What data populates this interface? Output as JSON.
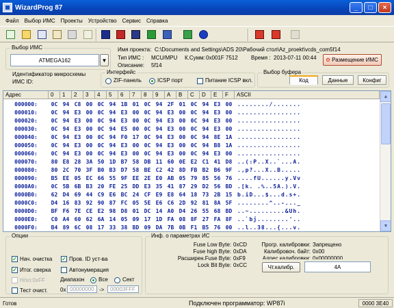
{
  "window": {
    "title": "WizardProg 87",
    "minimize": "_",
    "maximize": "□",
    "close": "×"
  },
  "menu": [
    "Файл",
    "Выбор ИМС",
    "Проекты",
    "Устройство",
    "Сервис",
    "Справка"
  ],
  "toolbar_icons": [
    "new-file-icon",
    "open-folder-icon",
    "save-icon",
    "reload-icon",
    "print-icon",
    "read-chip-icon",
    "erase-chip-icon",
    "blank-check-icon",
    "program-chip-icon",
    "verify-chip-icon",
    "auto-icon",
    "info-icon",
    "device-setup-icon",
    "device-select-icon",
    "disabled-edit-icon"
  ],
  "chip_select": {
    "title": "Выбор ИМС",
    "value": "ATMEGA162"
  },
  "project": {
    "name_label": "Имя проекта:",
    "name_value": "C:\\Documents and Settings\\ADS 20\\Рабочий стол\\Az_proekt\\vcds_com5f14",
    "type_label": "Тип ИМС :",
    "type_value": "MCU/MPU",
    "checksum_label": "К.Сумм:",
    "checksum_value": "0x001F 7512",
    "time_label": "Время :",
    "time_value": "2013-07-11 00:44",
    "desc_label": "Описание:",
    "desc_value": "5f14",
    "placement_button": "Размещение ИМС"
  },
  "chip_id": {
    "title": "Идентификатор микросхемы",
    "label": "ИМС ID:"
  },
  "interface": {
    "title": "Интерфейс",
    "zif": "ZIF-панель",
    "icsp": "ICSP порт",
    "icsp_power": "Питание ICSP вкл."
  },
  "buffer": {
    "title": "Выбор буфера",
    "tabs": [
      "Код",
      "Данные",
      "Конфиг"
    ]
  },
  "hex": {
    "headers": [
      "Адрес",
      "0",
      "1",
      "2",
      "3",
      "4",
      "5",
      "6",
      "7",
      "8",
      "9",
      "A",
      "B",
      "C",
      "D",
      "E",
      "F",
      "ASCII"
    ],
    "rows": [
      {
        "addr": "000000:",
        "bytes": [
          "0C",
          "94",
          "C8",
          "00",
          "0C",
          "94",
          "1B",
          "01",
          "0C",
          "94",
          "2F",
          "01",
          "0C",
          "94",
          "E3",
          "00"
        ],
        "ascii": "......../......."
      },
      {
        "addr": "000010:",
        "bytes": [
          "0C",
          "94",
          "E3",
          "00",
          "0C",
          "94",
          "E3",
          "00",
          "0C",
          "94",
          "E3",
          "00",
          "0C",
          "94",
          "E3",
          "00"
        ],
        "ascii": "................"
      },
      {
        "addr": "000020:",
        "bytes": [
          "0C",
          "94",
          "E3",
          "00",
          "0C",
          "94",
          "E3",
          "00",
          "0C",
          "94",
          "E3",
          "00",
          "0C",
          "94",
          "E3",
          "00"
        ],
        "ascii": "................"
      },
      {
        "addr": "000030:",
        "bytes": [
          "0C",
          "94",
          "E3",
          "00",
          "0C",
          "94",
          "E5",
          "00",
          "0C",
          "94",
          "E3",
          "00",
          "0C",
          "94",
          "E3",
          "00"
        ],
        "ascii": "................"
      },
      {
        "addr": "000040:",
        "bytes": [
          "0C",
          "94",
          "E3",
          "00",
          "0C",
          "94",
          "F0",
          "17",
          "0C",
          "94",
          "E3",
          "00",
          "0C",
          "94",
          "8E",
          "1A"
        ],
        "ascii": "................"
      },
      {
        "addr": "000050:",
        "bytes": [
          "0C",
          "94",
          "E3",
          "00",
          "0C",
          "94",
          "E3",
          "00",
          "0C",
          "94",
          "E3",
          "00",
          "0C",
          "94",
          "B8",
          "1A"
        ],
        "ascii": "................"
      },
      {
        "addr": "000060:",
        "bytes": [
          "0C",
          "94",
          "E3",
          "00",
          "0C",
          "94",
          "E3",
          "00",
          "0C",
          "94",
          "E3",
          "00",
          "0C",
          "94",
          "E3",
          "00"
        ],
        "ascii": "................"
      },
      {
        "addr": "000070:",
        "bytes": [
          "80",
          "E8",
          "28",
          "3A",
          "50",
          "1D",
          "B7",
          "58",
          "DB",
          "11",
          "60",
          "0E",
          "E2",
          "C1",
          "41",
          "D8"
        ],
        "ascii": "..(:P..X..`...A."
      },
      {
        "addr": "000080:",
        "bytes": [
          "80",
          "2C",
          "70",
          "3F",
          "B0",
          "B3",
          "D7",
          "58",
          "BE",
          "C2",
          "42",
          "8D",
          "FB",
          "B2",
          "B6",
          "9F"
        ],
        "ascii": ".,p?...X..B....."
      },
      {
        "addr": "000090:",
        "bytes": [
          "B5",
          "EE",
          "05",
          "EC",
          "66",
          "55",
          "9F",
          "EE",
          "2E",
          "E0",
          "AB",
          "05",
          "79",
          "85",
          "56",
          "76"
        ],
        "ascii": "....fU......y.Vv"
      },
      {
        "addr": "0000A0:",
        "bytes": [
          "0C",
          "5B",
          "6B",
          "B3",
          "20",
          "FE",
          "25",
          "DD",
          "E3",
          "35",
          "41",
          "87",
          "29",
          "D2",
          "56",
          "BD"
        ],
        "ascii": ".[k. .%..5A.).V."
      },
      {
        "addr": "0000B0:",
        "bytes": [
          "62",
          "D4",
          "69",
          "44",
          "C9",
          "E6",
          "BC",
          "24",
          "CF",
          "E9",
          "E8",
          "64",
          "18",
          "73",
          "2B",
          "15"
        ],
        "ascii": "b.iD...$...d.s+."
      },
      {
        "addr": "0000C0:",
        "bytes": [
          "D4",
          "16",
          "83",
          "92",
          "90",
          "87",
          "FC",
          "05",
          "5E",
          "E6",
          "C6",
          "2D",
          "92",
          "81",
          "8A",
          "5F"
        ],
        "ascii": "........^..-..._"
      },
      {
        "addr": "0000D0:",
        "bytes": [
          "BF",
          "F6",
          "7E",
          "CE",
          "E2",
          "98",
          "D8",
          "01",
          "DC",
          "14",
          "A0",
          "D4",
          "26",
          "55",
          "68",
          "BD"
        ],
        "ascii": "..~.........&Uh."
      },
      {
        "addr": "0000E0:",
        "bytes": [
          "C0",
          "A4",
          "60",
          "62",
          "6A",
          "14",
          "05",
          "09",
          "17",
          "1D",
          "FA",
          "08",
          "8F",
          "27",
          "FA",
          "8F"
        ],
        "ascii": "..`bj........'.."
      },
      {
        "addr": "0000F0:",
        "bytes": [
          "B4",
          "89",
          "6C",
          "08",
          "17",
          "33",
          "38",
          "BD",
          "09",
          "DA",
          "7B",
          "0B",
          "F1",
          "B5",
          "76",
          "00"
        ],
        "ascii": "..l..38...{...v."
      }
    ]
  },
  "options": {
    "title": "Опции",
    "items": [
      {
        "label": "Нач. очистка",
        "checked": true,
        "enabled": true
      },
      {
        "label": "Пров. ID уст-ва",
        "checked": true,
        "enabled": true
      },
      {
        "label": "Итог. сверка",
        "checked": true,
        "enabled": true
      },
      {
        "label": "Автонумерация",
        "checked": false,
        "enabled": true
      },
      {
        "label": "H/sn:0xFF",
        "checked": false,
        "enabled": false
      },
      {
        "label": "Тест очист.",
        "checked": false,
        "enabled": true
      }
    ],
    "range_label": "Диапазон",
    "range_all": "Все",
    "range_sector": "Сект",
    "from_prefix": "0x",
    "from_value": "00000000",
    "arrow": "->",
    "to_value": "00003FFF"
  },
  "chip_info": {
    "title": "Инф. о параметрах ИС",
    "rows": [
      {
        "label": "Fuse Low Byte:",
        "value": "0xCD"
      },
      {
        "label": "Fuse high Byte:",
        "value": "0xDA"
      },
      {
        "label": "Расширен.Fuse Byte:",
        "value": "0xF9"
      },
      {
        "label": "Lock Bit Byte:",
        "value": "0xCC"
      }
    ],
    "cal": [
      {
        "label": "Прогр. калибровки:",
        "value": "Запрещено"
      },
      {
        "label": "Калибровоч. байт:",
        "value": "0x00"
      },
      {
        "label": "Адрес калибровки:",
        "value": "0x00000000"
      }
    ],
    "read_cal_button": "Чт.калибр.",
    "read_cal_value": "4A"
  },
  "status": {
    "left": "Готов",
    "center": "Подключен программатор: WP87i",
    "right": "0000 3E40"
  }
}
